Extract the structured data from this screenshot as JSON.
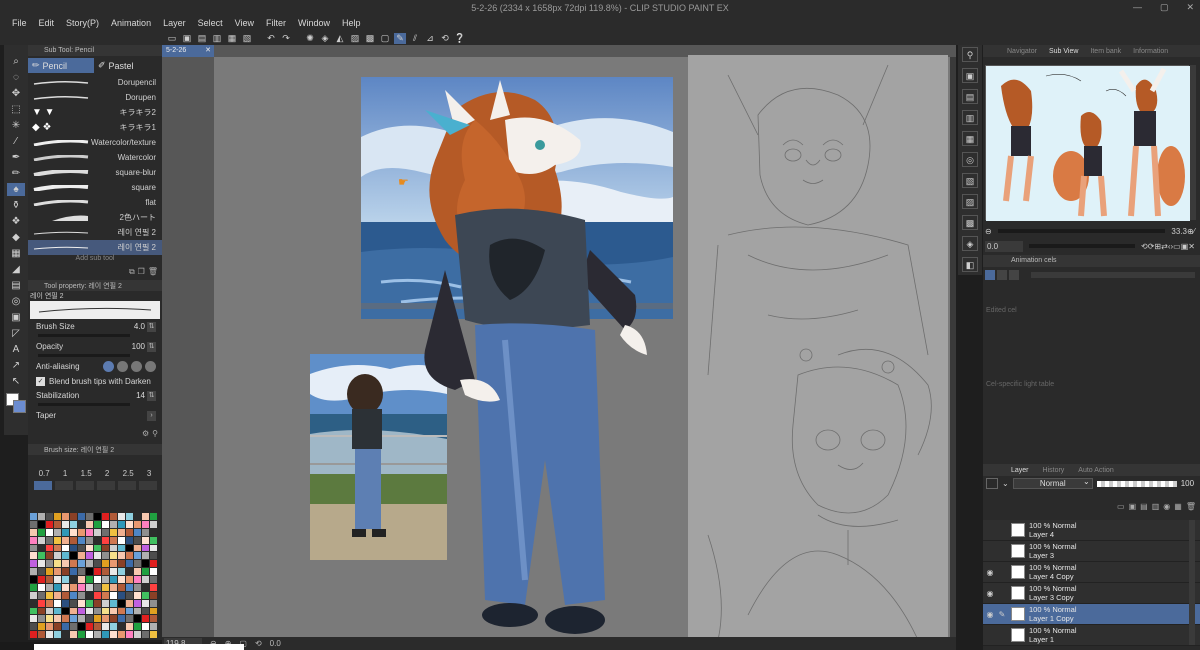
{
  "app": {
    "title": "5-2-26 (2334 x 1658px 72dpi 119.8%)  - CLIP STUDIO PAINT EX"
  },
  "menu": [
    "File",
    "Edit",
    "Story(P)",
    "Animation",
    "Layer",
    "Select",
    "View",
    "Filter",
    "Window",
    "Help"
  ],
  "document_tab": "5-2-26",
  "subtool_panel": {
    "header": "Sub Tool: Pencil",
    "tabs": [
      {
        "label": "Pencil",
        "active": true
      },
      {
        "label": "Pastel",
        "active": false
      }
    ],
    "brushes": [
      {
        "label": "Dorupencil",
        "active": false
      },
      {
        "label": "Dorupen",
        "active": false
      },
      {
        "label": "キラキラ2",
        "active": false
      },
      {
        "label": "キラキラ1",
        "active": false
      },
      {
        "label": "Watercolor/texture",
        "active": false
      },
      {
        "label": "Watercolor",
        "active": false
      },
      {
        "label": "square-blur",
        "active": false
      },
      {
        "label": "square",
        "active": false
      },
      {
        "label": "flat",
        "active": false
      },
      {
        "label": "2色ハート",
        "active": false
      },
      {
        "label": "레이 연필 2",
        "active": false
      },
      {
        "label": "레이 연필 2",
        "active": true
      }
    ],
    "add_subtool": "Add sub tool"
  },
  "tool_property": {
    "header": "Tool property: 레이 연필 2",
    "preset_name": "레이 연필 2",
    "brush_size_label": "Brush Size",
    "brush_size_value": "4.0",
    "opacity_label": "Opacity",
    "opacity_value": "100",
    "anti_aliasing_label": "Anti-aliasing",
    "blend_label": "Blend brush tips with Darken",
    "stabilization_label": "Stabilization",
    "stabilization_value": "14",
    "taper_label": "Taper"
  },
  "brush_size_panel": {
    "header": "Brush size: 레이 연필 2",
    "sizes": [
      "0.7",
      "1",
      "1.5",
      "2",
      "2.5",
      "3"
    ]
  },
  "status_bar": {
    "zoom": "119.8",
    "rotation": "0.0"
  },
  "right_panel": {
    "tabs": [
      {
        "label": "Navigator",
        "active": false
      },
      {
        "label": "Sub View",
        "active": true
      },
      {
        "label": "Item bank",
        "active": false
      },
      {
        "label": "Information",
        "active": false
      }
    ],
    "subview_zoom": "33.3",
    "subview_rotation": "0.0",
    "animation_header": "Animation cels",
    "edited_cel": "Edited cel",
    "cel_light_table": "Cel-specific light table",
    "layer_tabs": [
      {
        "label": "Layer",
        "active": true
      },
      {
        "label": "History",
        "active": false
      },
      {
        "label": "Auto Action",
        "active": false
      }
    ],
    "blend_mode": "Normal",
    "layer_opacity": "100"
  },
  "layers": [
    {
      "blend": "100 % Normal",
      "name": "Layer 4",
      "visible": false,
      "selected": false,
      "editing": false
    },
    {
      "blend": "100 % Normal",
      "name": "Layer 3",
      "visible": false,
      "selected": false,
      "editing": false
    },
    {
      "blend": "100 % Normal",
      "name": "Layer 4 Copy",
      "visible": true,
      "selected": false,
      "editing": false
    },
    {
      "blend": "100 % Normal",
      "name": "Layer 3 Copy",
      "visible": true,
      "selected": false,
      "editing": false
    },
    {
      "blend": "100 % Normal",
      "name": "Layer 1 Copy",
      "visible": true,
      "selected": true,
      "editing": true
    },
    {
      "blend": "100 % Normal",
      "name": "Layer 1",
      "visible": false,
      "selected": false,
      "editing": false
    }
  ],
  "colors": {
    "accent": "#4b6a9b",
    "panel": "#2a2a2a",
    "canvas_bg": "#7a7a7a",
    "main_color": "#ffffff",
    "sub_color": "#6b8cd0"
  }
}
